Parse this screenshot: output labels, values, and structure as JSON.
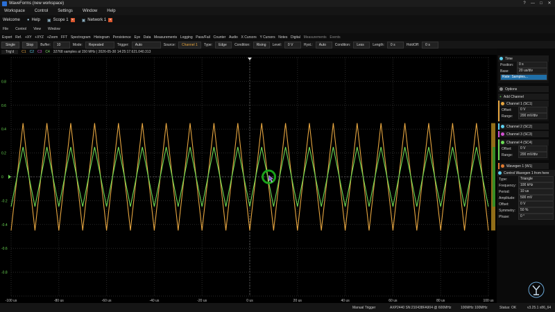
{
  "window": {
    "title": "WaveForms (new workspace)",
    "buttons": [
      "?",
      "—",
      "□",
      "✕"
    ]
  },
  "menu": [
    "Workspace",
    "Control",
    "Settings",
    "Window",
    "Help"
  ],
  "tabs": [
    {
      "label": "Welcome",
      "icon": "home-icon"
    },
    {
      "label": "Help",
      "icon": "help-icon"
    },
    {
      "label": "Scope 1",
      "icon": "scope-icon",
      "closable": true
    },
    {
      "label": "Network 1",
      "icon": "network-icon",
      "closable": true
    }
  ],
  "submenu": [
    "File",
    "Control",
    "View",
    "Window"
  ],
  "view_menu": [
    "Export",
    "Ref.",
    "+XY",
    "+XYZ",
    "+Zoom",
    "FFT",
    "Spectrogram",
    "Histogram",
    "Persistence",
    "Eye",
    "Data",
    "Measurements",
    "Logging",
    "Pass/Fail",
    "Counter",
    "Audio",
    "X Cursors",
    "Y Cursors",
    "Notes",
    "Digital",
    "Measurements",
    "Events"
  ],
  "toolbar": {
    "single": "Single",
    "stop": "Stop",
    "buffer_label": "Buffer:",
    "buffer_value": "10",
    "mode_label": "Mode:",
    "mode_value": "Repeated",
    "trigger_label": "Trigger:",
    "trigger_value": "Auto",
    "source_label": "Source:",
    "source_value": "Channel 1",
    "type_label": "Type:",
    "type_value": "Edge",
    "condition_label": "Condition:",
    "condition_value": "Rising",
    "level_label": "Level:",
    "level_value": "0 V",
    "hyst_label": "Hyst.:",
    "hyst_value": "Auto",
    "lcond_label": "Condition:",
    "lcond_value": "Less",
    "length_label": "Length:",
    "length_value": "0 s",
    "holdoff_label": "HoldOff:",
    "holdoff_value": "0 s"
  },
  "status_strip": {
    "trig": "Trig'd",
    "channels": [
      "C1",
      "C2",
      "C3",
      "C4"
    ],
    "info": "32768 samples at 150 MHz | 2026-05-30 14:25:17.621.040.313"
  },
  "plot": {
    "y_labels": [
      "0.8",
      "0.6",
      "0.4",
      "0.2",
      "0",
      "-0.2",
      "-0.4",
      "-0.6",
      "-0.8"
    ],
    "x_labels": [
      "-100 us",
      "-80 us",
      "-60 us",
      "-40 us",
      "-20 us",
      "0 us",
      "20 us",
      "40 us",
      "60 us",
      "80 us",
      "100 us"
    ],
    "colors": {
      "ch1": "#e7a640",
      "ch4": "#6ddc55",
      "grid": "#2b2b2b",
      "cursor": "#1aa31a"
    }
  },
  "chart_data": {
    "type": "line",
    "title": "",
    "xlabel": "",
    "ylabel": "",
    "xlim": [
      -100,
      100
    ],
    "ylim": [
      -1,
      1
    ],
    "x_unit": "us",
    "y_unit": "V",
    "series": [
      {
        "name": "Channel 1 (SC1)",
        "waveform": "triangle",
        "frequency_khz": 100,
        "amplitude_v": 0.45,
        "offset_v": 0,
        "periods": 20
      },
      {
        "name": "Channel 4 (SC4)",
        "waveform": "triangle",
        "frequency_khz": 100,
        "amplitude_v": 0.25,
        "offset_v": 0,
        "periods": 20
      }
    ]
  },
  "bottom": {
    "manual_trigger": "Manual Trigger",
    "device": "AXP2440 SN:210438FA904 @ 600MHz",
    "rate": "100MHz 100MHz",
    "status": "Status: OK",
    "version": "v3.25.1 x86_64"
  },
  "panel": {
    "time": {
      "title": "Time",
      "position_label": "Position:",
      "position": "0 s",
      "base_label": "Base:",
      "base": "20 us/div",
      "rate": "Rate: Samples..."
    },
    "options": "Options",
    "add_channel": "Add Channel",
    "channels": [
      {
        "title": "Channel 1 (SC1)",
        "color": "#e7a640",
        "offset_label": "Offset:",
        "offset": "0 V",
        "range_label": "Range:",
        "range": "200 mV/div",
        "expanded": true
      },
      {
        "title": "Channel 2 (SC2)",
        "color": "#5dd0f0",
        "expanded": false
      },
      {
        "title": "Channel 3 (SC3)",
        "color": "#d050d0",
        "expanded": false
      },
      {
        "title": "Channel 4 (SC4)",
        "color": "#6ddc55",
        "offset_label": "Offset:",
        "offset": "0 V",
        "range_label": "Range:",
        "range": "200 mV/div",
        "expanded": true
      }
    ],
    "wavegen_tab": "Wavegen 1 (W1)",
    "wavegen": {
      "title": "Control Wavegen 1 from here",
      "rows": [
        {
          "label": "Type:",
          "value": "Triangle"
        },
        {
          "label": "Frequency:",
          "value": "100 kHz"
        },
        {
          "label": "Period:",
          "value": "10 us"
        },
        {
          "label": "Amplitude:",
          "value": "500 mV"
        },
        {
          "label": "Offset:",
          "value": "0 V"
        },
        {
          "label": "Symmetry:",
          "value": "50 %"
        },
        {
          "label": "Phase:",
          "value": "0 °"
        }
      ]
    }
  }
}
